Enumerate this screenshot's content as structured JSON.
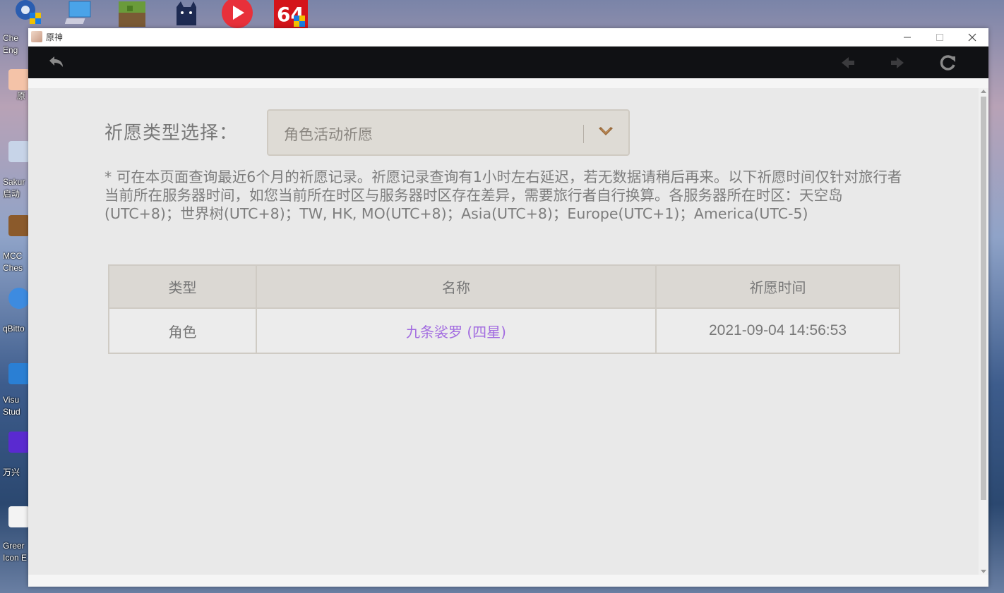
{
  "window": {
    "title": "原神"
  },
  "desktop": {
    "icons": [
      {
        "label": "Che\nEng",
        "color": "#2f6fd0"
      },
      {
        "label": "原",
        "color": "#f4c3a8"
      },
      {
        "label": "Sakur\n启动",
        "color": "#c7d4e8"
      },
      {
        "label": "MCC\nChes",
        "color": "#8b5a2b"
      },
      {
        "label": "qBitto",
        "color": "#3d8be0"
      },
      {
        "label": "Visu\nStud",
        "color": "#2a7fd4"
      },
      {
        "label": "万兴",
        "color": "#5a2ad0"
      },
      {
        "label": "Greer\nIcon E",
        "color": "#f3f3f3"
      }
    ]
  },
  "selector": {
    "label": "祈愿类型选择：",
    "value": "角色活动祈愿"
  },
  "notice": "* 可在本页面查询最近6个月的祈愿记录。祈愿记录查询有1小时左右延迟，若无数据请稍后再来。以下祈愿时间仅针对旅行者当前所在服务器时间，如您当前所在时区与服务器时区存在差异，需要旅行者自行换算。各服务器所在时区：天空岛(UTC+8)；世界树(UTC+8)；TW, HK, MO(UTC+8)；Asia(UTC+8)；Europe(UTC+1)；America(UTC-5)",
  "table": {
    "headers": [
      "类型",
      "名称",
      "祈愿时间"
    ],
    "rows": [
      {
        "type": "角色",
        "name": "九条裟罗 (四星)",
        "time": "2021-09-04 14:56:53"
      }
    ]
  },
  "colors": {
    "toolbar": "#101114",
    "page_bg": "#e9e9e9",
    "four_star": "#a26be0"
  }
}
